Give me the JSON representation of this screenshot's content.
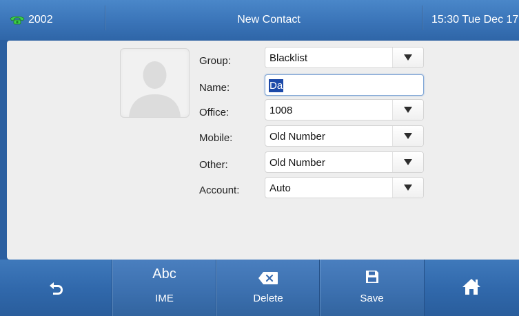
{
  "status_bar": {
    "line_number": "2002",
    "title": "New Contact",
    "clock": "15:30 Tue Dec 17"
  },
  "form": {
    "fields": [
      {
        "label": "Group:",
        "value": "Blacklist",
        "type": "dropdown"
      },
      {
        "label": "Name:",
        "value": "Da",
        "type": "text"
      },
      {
        "label": "Office:",
        "value": "1008",
        "type": "dropdown"
      },
      {
        "label": "Mobile:",
        "value": "Old Number",
        "type": "dropdown"
      },
      {
        "label": "Other:",
        "value": "Old Number",
        "type": "dropdown"
      },
      {
        "label": "Account:",
        "value": "Auto",
        "type": "dropdown"
      }
    ]
  },
  "softkeys": {
    "back_icon": "back-arrow-icon",
    "ime": {
      "top": "Abc",
      "label": "IME"
    },
    "delete": {
      "icon": "backspace-icon",
      "label": "Delete"
    },
    "save": {
      "icon": "floppy-disk-icon",
      "label": "Save"
    },
    "home_icon": "home-icon"
  },
  "colors": {
    "accent": "#3a74b8",
    "selection": "#1c49a8",
    "phone_icon": "#3dcf4a"
  }
}
